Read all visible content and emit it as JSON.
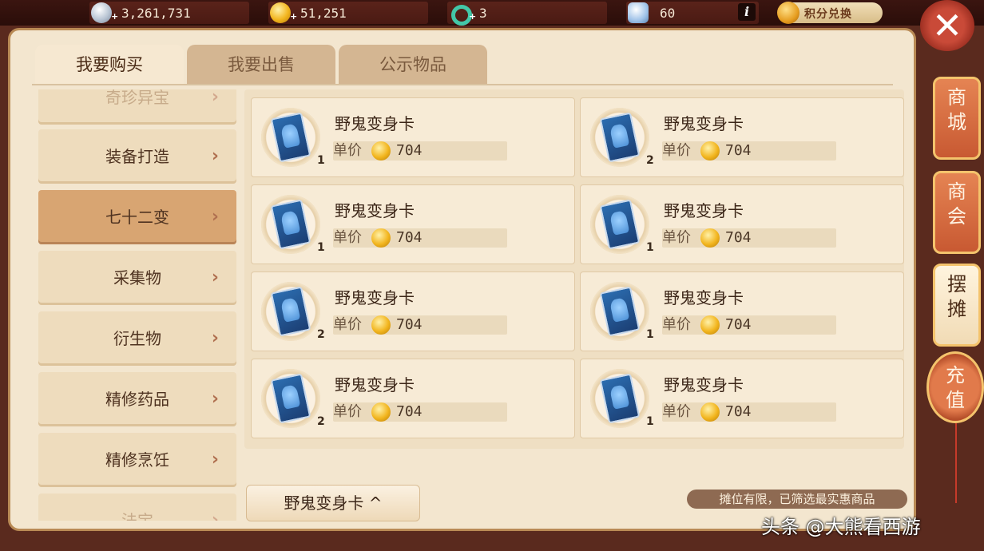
{
  "currencies": [
    {
      "icon": "silver-coin-icon",
      "value": "3,261,731"
    },
    {
      "icon": "gold-coin-icon",
      "value": "51,251"
    },
    {
      "icon": "green-ring-icon",
      "value": "3"
    },
    {
      "icon": "bag-icon",
      "value": "60"
    }
  ],
  "info_label": "i",
  "points_exchange_label": "积分兑换",
  "close_label": "✕",
  "tabs": [
    {
      "label": "我要购买",
      "active": true
    },
    {
      "label": "我要出售",
      "active": false
    },
    {
      "label": "公示物品",
      "active": false
    }
  ],
  "categories": [
    {
      "label": "奇珍异宝",
      "selected": false
    },
    {
      "label": "装备打造",
      "selected": false
    },
    {
      "label": "七十二变",
      "selected": true
    },
    {
      "label": "采集物",
      "selected": false
    },
    {
      "label": "衍生物",
      "selected": false
    },
    {
      "label": "精修药品",
      "selected": false
    },
    {
      "label": "精修烹饪",
      "selected": false
    },
    {
      "label": "法宝",
      "selected": false
    }
  ],
  "chevron": "›",
  "price_label": "单价",
  "items": [
    {
      "name": "野鬼变身卡",
      "price": "704",
      "qty": "1"
    },
    {
      "name": "野鬼变身卡",
      "price": "704",
      "qty": "2"
    },
    {
      "name": "野鬼变身卡",
      "price": "704",
      "qty": "1"
    },
    {
      "name": "野鬼变身卡",
      "price": "704",
      "qty": "1"
    },
    {
      "name": "野鬼变身卡",
      "price": "704",
      "qty": "2"
    },
    {
      "name": "野鬼变身卡",
      "price": "704",
      "qty": "1"
    },
    {
      "name": "野鬼变身卡",
      "price": "704",
      "qty": "2"
    },
    {
      "name": "野鬼变身卡",
      "price": "704",
      "qty": "1"
    }
  ],
  "filter_button": "野鬼变身卡 ^",
  "notice": "摊位有限，已筛选最实惠商品",
  "side_buttons": [
    {
      "label": "商\n城",
      "active": false
    },
    {
      "label": "商\n会",
      "active": false
    },
    {
      "label": "摆\n摊",
      "active": true
    }
  ],
  "recharge_label": "充\n值",
  "watermark": "头条 @大熊看西游"
}
